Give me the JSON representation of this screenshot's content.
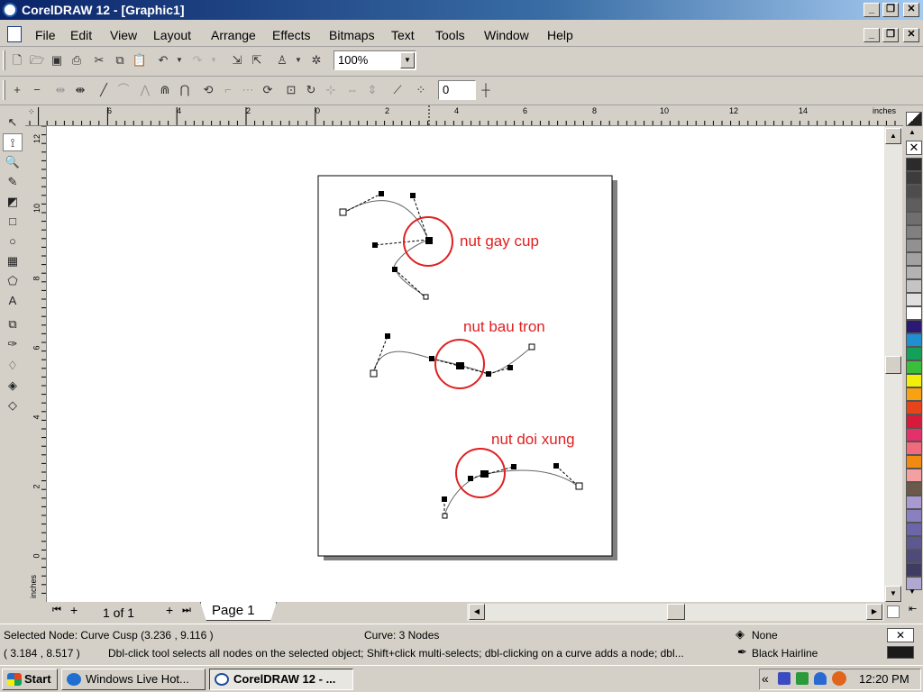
{
  "window": {
    "title": "CorelDRAW 12 - [Graphic1]",
    "min": "_",
    "max": "❐",
    "close": "✕"
  },
  "menu": [
    "File",
    "Edit",
    "View",
    "Layout",
    "Arrange",
    "Effects",
    "Bitmaps",
    "Text",
    "Tools",
    "Window",
    "Help"
  ],
  "toolbar": {
    "zoom": "100%",
    "nudge": "0"
  },
  "ruler": {
    "unit": "inches",
    "h_ticks": [
      "6",
      "4",
      "2",
      "0",
      "2",
      "4",
      "6",
      "8",
      "10",
      "12",
      "14"
    ],
    "v_ticks": [
      "12",
      "10",
      "8",
      "6",
      "4",
      "2",
      "0"
    ]
  },
  "canvas": {
    "annotations": [
      "nut gay cup",
      "nut bau tron",
      "nut doi xung"
    ]
  },
  "page_nav": {
    "count": "1 of 1",
    "tab": "Page 1"
  },
  "status": {
    "selected": "Selected Node: Curve Cusp (3.236 , 9.116 )",
    "curve": "Curve: 3 Nodes",
    "coords": "( 3.184 , 8.517 )",
    "hint": "Dbl-click tool selects all nodes on the selected object; Shift+click multi-selects; dbl-clicking on a curve adds a node; dbl...",
    "fill": "None",
    "outline": "Black  Hairline"
  },
  "taskbar": {
    "start": "Start",
    "items": [
      "Windows Live Hot...",
      "CorelDRAW 12 - ..."
    ],
    "clock": "12:20 PM",
    "tray_chevron": "«"
  },
  "palette_colors": [
    "#2b2b2b",
    "#3c3c3c",
    "#4d4d4d",
    "#5e5e5e",
    "#6f6f6f",
    "#808080",
    "#919191",
    "#a2a2a2",
    "#b3b3b3",
    "#c4c4c4",
    "#e0e0e0",
    "#ffffff",
    "#2b1a73",
    "#1f8fd0",
    "#12a05a",
    "#3bbf3b",
    "#f2ef0a",
    "#f6a213",
    "#e8441c",
    "#d81a3a",
    "#e4306b",
    "#f26a7d",
    "#f08a10",
    "#f5a0a0",
    "#6b5a4a",
    "#a89ad0",
    "#8a80c0",
    "#6b66a8",
    "#5d5890",
    "#4e4a7a",
    "#3f3c64",
    "#b0a8d0"
  ]
}
